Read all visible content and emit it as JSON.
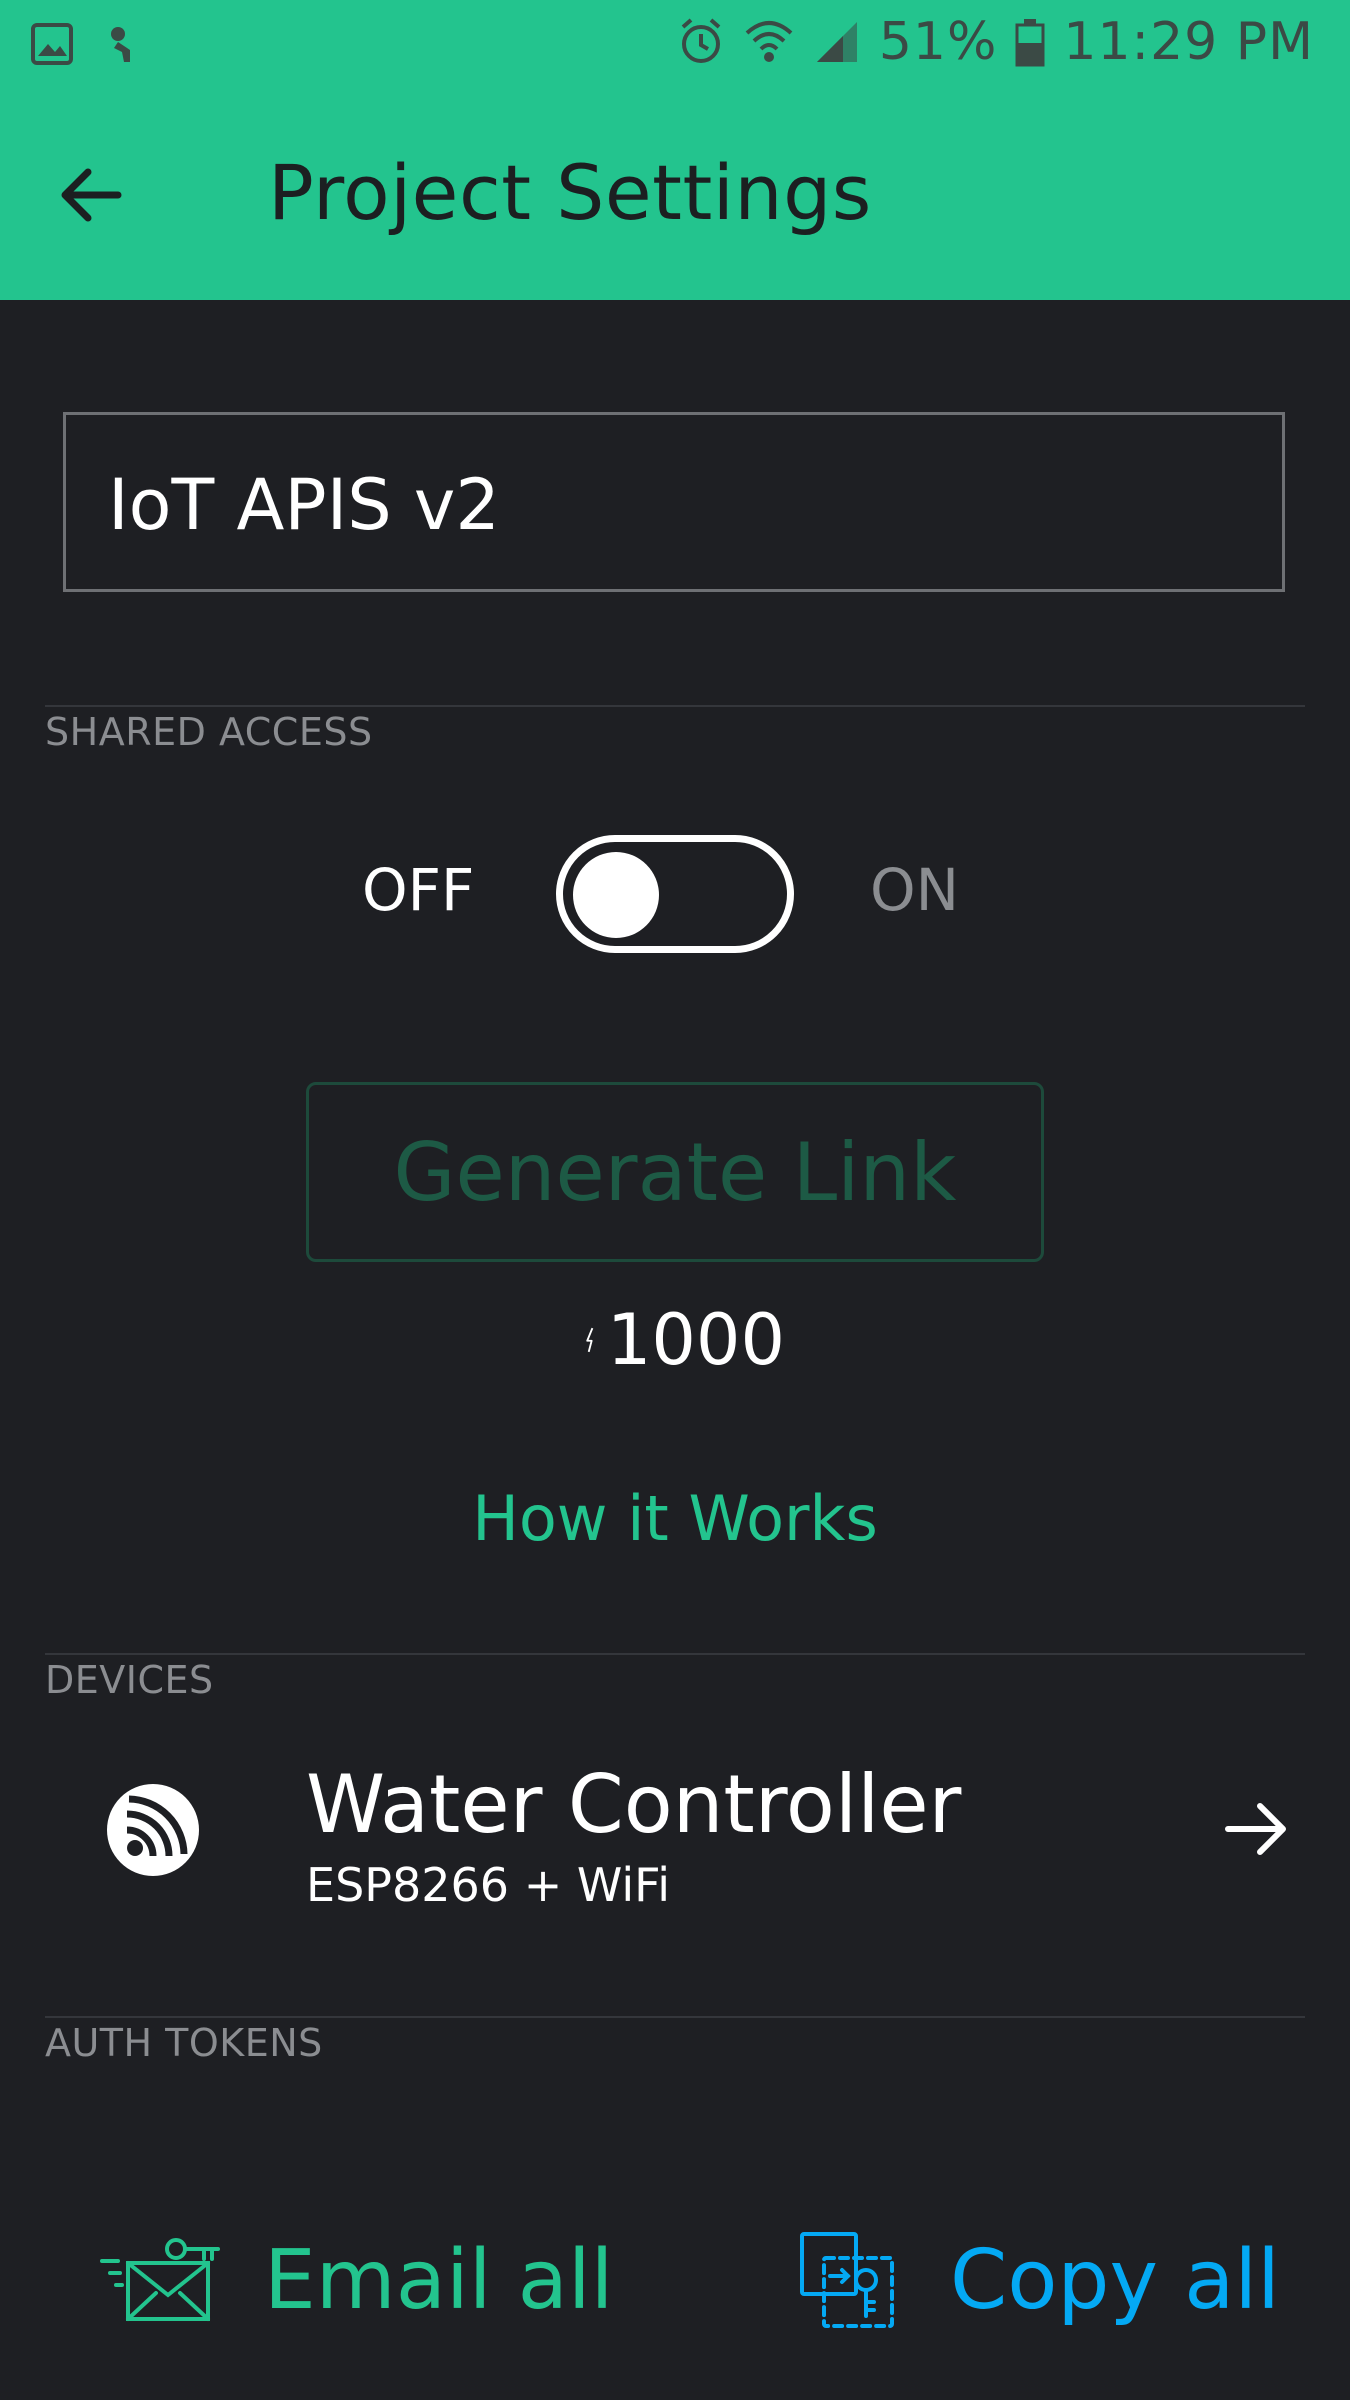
{
  "status_bar": {
    "battery": "51%",
    "time": "11:29 PM",
    "icons": [
      "image-icon",
      "notification-icon",
      "alarm-icon",
      "wifi-icon",
      "signal-icon",
      "battery-icon"
    ]
  },
  "app_bar": {
    "title": "Project Settings",
    "back_icon": "arrow-left-icon",
    "color": "#23c48e"
  },
  "project_name": {
    "value": "IoT APIS v2"
  },
  "shared_access": {
    "section_label": "SHARED ACCESS",
    "off_label": "OFF",
    "on_label": "ON",
    "enabled": false,
    "generate_link_label": "Generate Link",
    "energy_cost": "1000",
    "energy_icon": "lightning-icon",
    "how_it_works_label": "How it Works"
  },
  "devices": {
    "section_label": "DEVICES",
    "items": [
      {
        "name": "Water Controller",
        "type": "ESP8266 + WiFi",
        "icon": "esp-wifi-icon"
      }
    ]
  },
  "auth_tokens": {
    "section_label": "AUTH TOKENS",
    "email_all_label": "Email all",
    "copy_all_label": "Copy all",
    "email_color": "#23c48e",
    "copy_color": "#04a9f4"
  }
}
